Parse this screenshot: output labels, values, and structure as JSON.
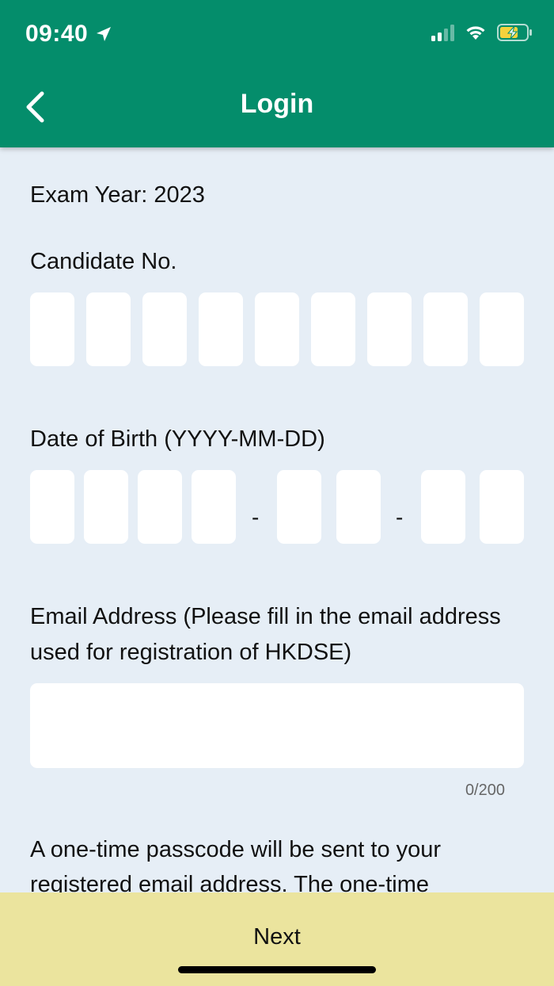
{
  "status_bar": {
    "time": "09:40"
  },
  "header": {
    "title": "Login",
    "bg_color": "#048d6b"
  },
  "form": {
    "exam_year": "Exam Year: 2023",
    "candidate_label": "Candidate No.",
    "dob_label": "Date of Birth (YYYY-MM-DD)",
    "dob_separator": "-",
    "email_label": "Email Address (Please fill in the email address used for registration of HKDSE)",
    "email_value": "",
    "email_counter": "0/200",
    "note": "A one-time passcode will be sent to your registered email address. The one-time"
  },
  "footer": {
    "next_label": "Next",
    "bg_color": "#ebe49e"
  }
}
